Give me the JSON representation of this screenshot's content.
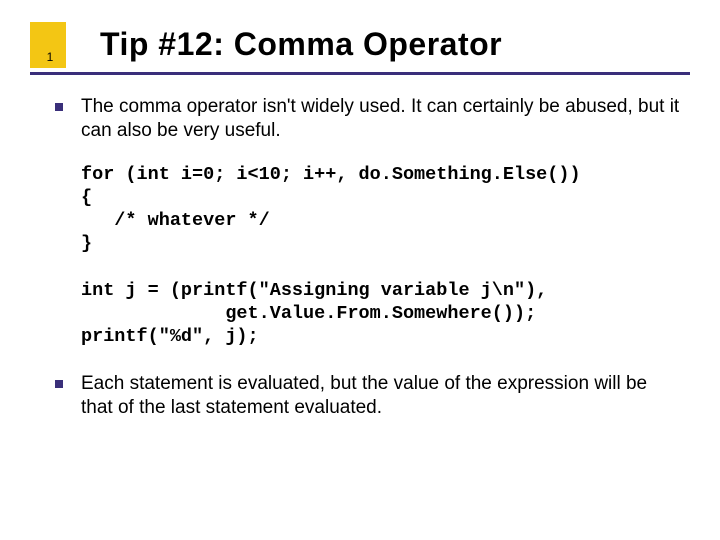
{
  "page_number": "1",
  "title": "Tip #12: Comma Operator",
  "bullets": {
    "b1": "The comma operator isn't widely used. It can certainly be abused, but it can also be very useful.",
    "b2": "Each statement is evaluated, but the value of the expression will be that of the last statement evaluated."
  },
  "code": {
    "block1": "for (int i=0; i<10; i++, do.Something.Else())\n{\n   /* whatever */\n}",
    "block2": "int j = (printf(\"Assigning variable j\\n\"),\n             get.Value.From.Somewhere());\nprintf(\"%d\", j);"
  }
}
